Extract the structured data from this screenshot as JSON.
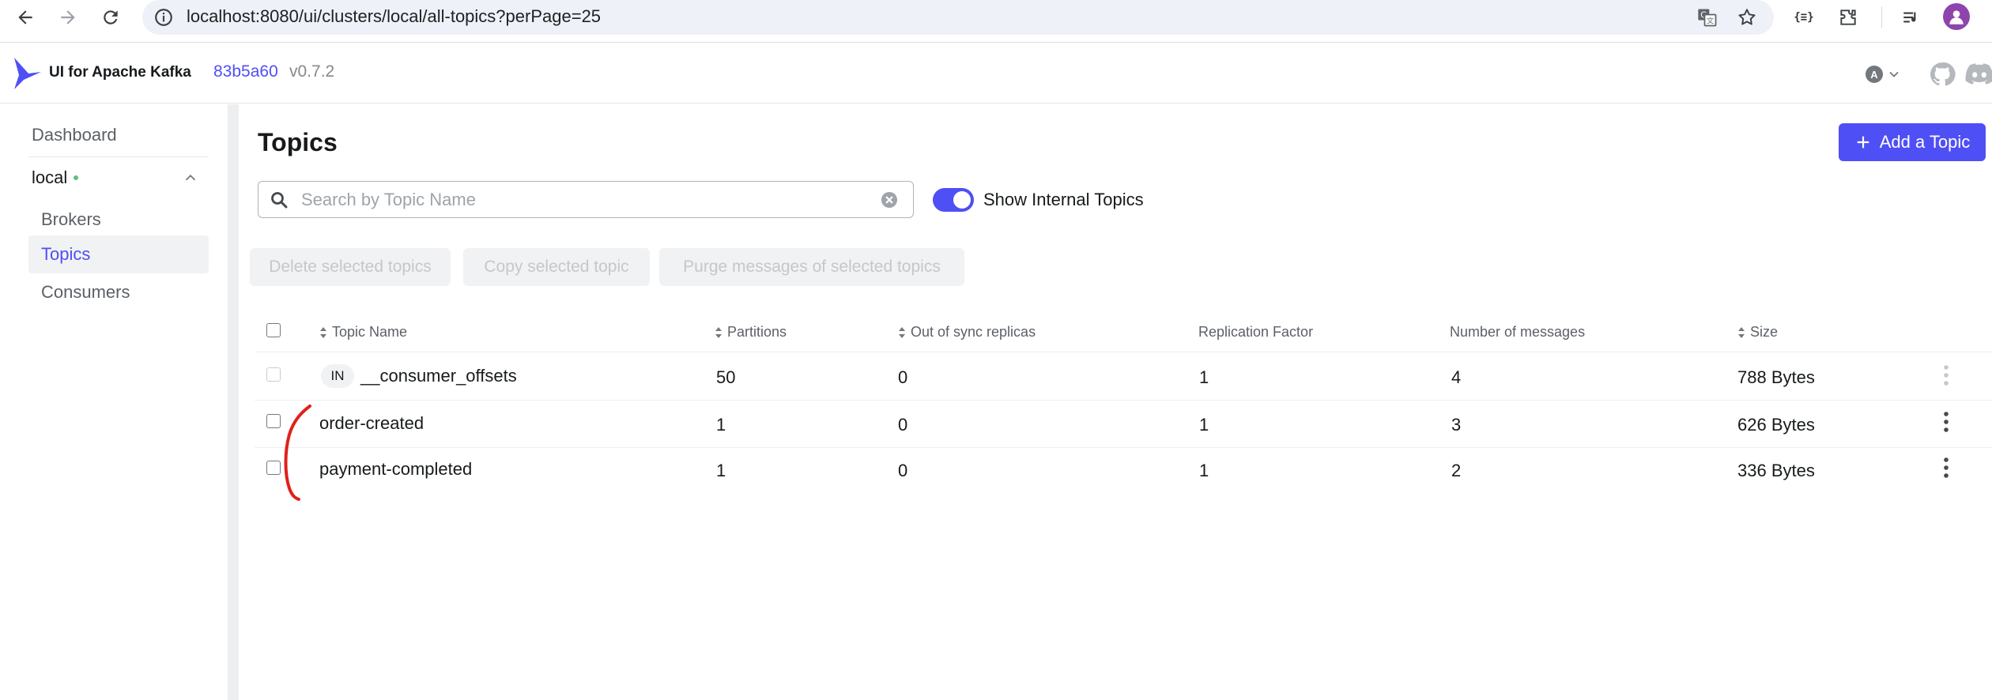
{
  "browser": {
    "url": "localhost:8080/ui/clusters/local/all-topics?perPage=25"
  },
  "header": {
    "app_title": "UI for Apache Kafka",
    "commit": "83b5a60",
    "version": "v0.7.2",
    "lang_letter": "A"
  },
  "sidebar": {
    "dashboard": "Dashboard",
    "cluster": "local",
    "items": [
      {
        "label": "Brokers"
      },
      {
        "label": "Topics"
      },
      {
        "label": "Consumers"
      }
    ]
  },
  "main": {
    "title": "Topics",
    "add_button": "Add a Topic",
    "search_placeholder": "Search by Topic Name",
    "toggle_label": "Show Internal Topics",
    "actions": [
      "Delete selected topics",
      "Copy selected topic",
      "Purge messages of selected topics"
    ],
    "columns": [
      "Topic Name",
      "Partitions",
      "Out of sync replicas",
      "Replication Factor",
      "Number of messages",
      "Size"
    ],
    "rows": [
      {
        "badge": "IN",
        "name": "__consumer_offsets",
        "partitions": "50",
        "out_of_sync": "0",
        "replication": "1",
        "messages": "4",
        "size": "788 Bytes"
      },
      {
        "name": "order-created",
        "partitions": "1",
        "out_of_sync": "0",
        "replication": "1",
        "messages": "3",
        "size": "626 Bytes"
      },
      {
        "name": "payment-completed",
        "partitions": "1",
        "out_of_sync": "0",
        "replication": "1",
        "messages": "2",
        "size": "336 Bytes"
      }
    ]
  },
  "colors": {
    "accent": "#4f4ff6",
    "annotation": "#e0201b",
    "online": "#5bc17f"
  }
}
